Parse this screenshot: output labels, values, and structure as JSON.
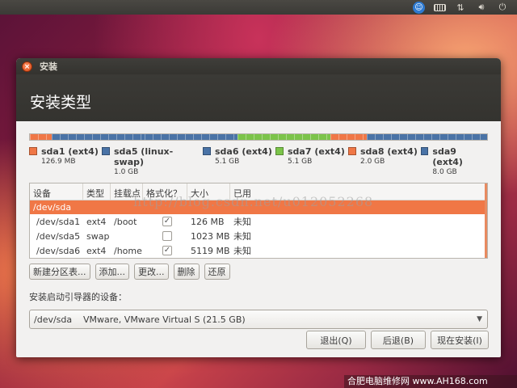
{
  "window": {
    "title": "安装"
  },
  "header": {
    "title": "安装类型"
  },
  "partitions_bar": [
    {
      "name": "sda1 (ext4)",
      "size": "126.9 MB",
      "color": "#f07746"
    },
    {
      "name": "sda5 (linux-swap)",
      "size": "1.0 GB",
      "color": "#4a73a6"
    },
    {
      "name": "sda6 (ext4)",
      "size": "5.1 GB",
      "color": "#4a73a6"
    },
    {
      "name": "sda7 (ext4)",
      "size": "5.1 GB",
      "color": "#7cc44a"
    },
    {
      "name": "sda8 (ext4)",
      "size": "2.0 GB",
      "color": "#f07746"
    },
    {
      "name": "sda9 (ext4)",
      "size": "8.0 GB",
      "color": "#4a73a6"
    }
  ],
  "table": {
    "headers": [
      "设备",
      "类型",
      "挂载点",
      "格式化？",
      "大小",
      "已用"
    ],
    "device_row": "/dev/sda",
    "rows": [
      {
        "device": "/dev/sda1",
        "type": "ext4",
        "mount": "/boot",
        "format": true,
        "size": "126 MB",
        "used": "未知"
      },
      {
        "device": "/dev/sda5",
        "type": "swap",
        "mount": "",
        "format": false,
        "size": "1023 MB",
        "used": "未知"
      },
      {
        "device": "/dev/sda6",
        "type": "ext4",
        "mount": "/home",
        "format": true,
        "size": "5119 MB",
        "used": "未知"
      }
    ]
  },
  "actions": {
    "new_table": "新建分区表...",
    "add": "添加...",
    "change": "更改...",
    "delete": "删除",
    "revert": "还原"
  },
  "boot": {
    "label": "安装启动引导器的设备：",
    "device": "/dev/sda",
    "description": "VMware, VMware Virtual S (21.5 GB)"
  },
  "footer": {
    "quit": "退出(Q)",
    "back": "后退(B)",
    "install": "现在安装(I)"
  },
  "watermark": "http://blog.csdn.net/u012052268",
  "corner_watermark": "合肥电脑维修网 www.AH168.com"
}
